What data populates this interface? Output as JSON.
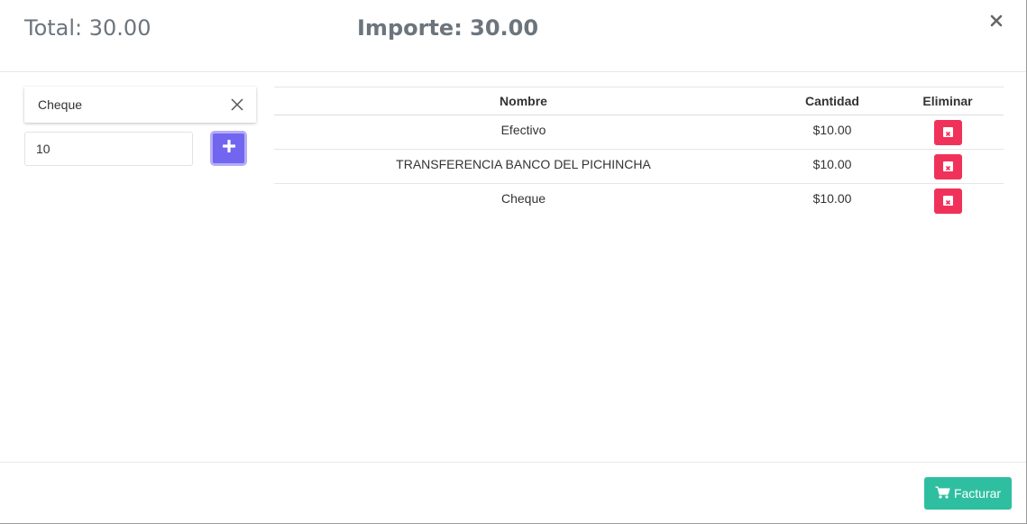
{
  "header": {
    "total_text": "Total: 30.00",
    "importe_text": "Importe: 30.00"
  },
  "payment_form": {
    "selected_method": "Cheque",
    "amount_value": "10"
  },
  "table": {
    "columns": [
      "Nombre",
      "Cantidad",
      "Eliminar"
    ],
    "rows": [
      {
        "nombre": "Efectivo",
        "cantidad": "$10.00"
      },
      {
        "nombre": "TRANSFERENCIA BANCO DEL PICHINCHA",
        "cantidad": "$10.00"
      },
      {
        "nombre": "Cheque",
        "cantidad": "$10.00"
      }
    ]
  },
  "footer": {
    "facturar_label": "Facturar"
  },
  "colors": {
    "add_button": "#7266f0",
    "delete_button": "#f0325a",
    "facturar_button": "#2ebfa0"
  },
  "icons": {
    "close": "close-icon",
    "clear": "clear-icon",
    "add": "plus-icon",
    "delete": "delete-icon",
    "cart": "cart-icon"
  }
}
